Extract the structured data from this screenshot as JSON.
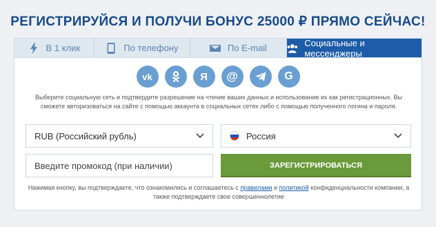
{
  "title": "РЕГИСТРИРУЙСЯ И ПОЛУЧИ БОНУС 25000 ₽ ПРЯМО СЕЙЧАС!",
  "tabs": [
    {
      "label": "В 1 клик",
      "icon": "lightning-icon"
    },
    {
      "label": "По телефону",
      "icon": "phone-icon"
    },
    {
      "label": "По E-mail",
      "icon": "envelope-icon"
    },
    {
      "label": "Социальные и мессенджеры",
      "icon": "users-icon",
      "active": true
    }
  ],
  "socials": [
    {
      "name": "vk-icon",
      "glyph": "vk"
    },
    {
      "name": "odnoklassniki-icon"
    },
    {
      "name": "yandex-icon",
      "glyph": "Я"
    },
    {
      "name": "mailru-icon",
      "glyph": "@"
    },
    {
      "name": "telegram-icon"
    },
    {
      "name": "google-icon",
      "glyph": "G"
    }
  ],
  "info_text": "Выберите социальную сеть и подтвердите разрешение на чтение ваших данных и использование их как регистрационных. Вы сможете авторизоваться на сайте с помощью аккаунта в социальных сетях либо с помощью полученного логина и пароля.",
  "currency": {
    "value": "RUB (Российский рубль)"
  },
  "country": {
    "value": "Россия"
  },
  "promo": {
    "placeholder": "Введите промокод (при наличии)"
  },
  "register_button": "ЗАРЕГИСТРИРОВАТЬСЯ",
  "terms": {
    "part1": "Нажимая кнопку, вы подтверждаете, что ознакомились и соглашаетесь с ",
    "rules_link": "правилами",
    "and": " и ",
    "policy_link": "политикой",
    "part2": " конфиденциальности компании, а также подтверждаете свое совершеннолетие"
  },
  "colors": {
    "brand_blue": "#1c5ca8",
    "title_blue": "#174a8a",
    "social_blue": "#6b9fd1",
    "register_green": "#6a9a3a"
  }
}
